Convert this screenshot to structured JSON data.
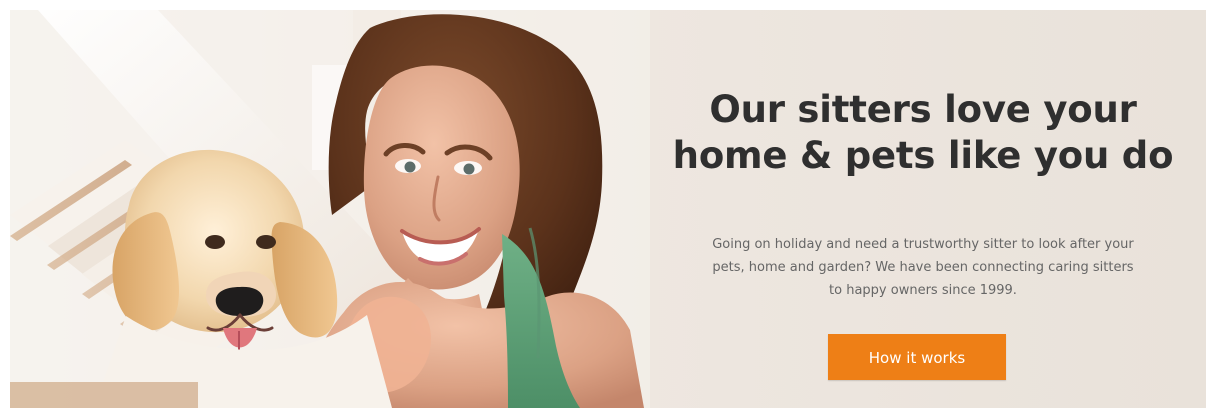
{
  "hero": {
    "headline_line1": "Our sitters love your",
    "headline_line2": "home & pets like you do",
    "body_line1": "Going on holiday and need a trustworthy sitter to look after your",
    "body_line2": "pets, home and garden? We have been connecting caring sitters",
    "body_line3": "to happy owners since 1999.",
    "cta_label": "How it works",
    "image_alt": "A smiling woman with a golden retriever puppy on a staircase",
    "colors": {
      "cta": "#ee7f16",
      "headline": "#2f2f2f",
      "body": "#666666",
      "background": "#eee7e0"
    }
  }
}
